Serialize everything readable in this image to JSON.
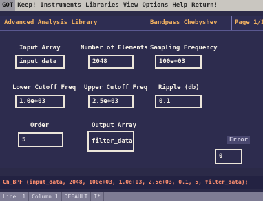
{
  "menu": [
    "GOT",
    "Keep!",
    "Instruments",
    "Libraries",
    "View",
    "Options",
    "Help",
    "Return!"
  ],
  "header": {
    "title": "Advanced Analysis Library",
    "function": "Bandpass Chebyshev",
    "page": "Page 1/1"
  },
  "fields": {
    "input_array": {
      "label": "Input Array",
      "value": "input_data"
    },
    "num_elements": {
      "label": "Number of Elements",
      "value": "2048"
    },
    "sampling_freq": {
      "label": "Sampling Frequency",
      "value": "100e+03"
    },
    "lower_cutoff": {
      "label": "Lower Cutoff Freq",
      "value": "1.0e+03"
    },
    "upper_cutoff": {
      "label": "Upper Cutoff Freq",
      "value": "2.5e+03"
    },
    "ripple": {
      "label": "Ripple (db)",
      "value": "0.1"
    },
    "order": {
      "label": "Order",
      "value": "5"
    },
    "output_array": {
      "label": "Output Array",
      "value": "filter_data"
    },
    "error": {
      "label": "Error",
      "value": "0"
    }
  },
  "command": "Ch_BPF (input_data, 2048, 100e+03, 1.0e+03, 2.5e+03, 0.1, 5, filter_data);",
  "status": [
    "Line",
    "1",
    "Column 1",
    "DEFAULT",
    "I*"
  ]
}
